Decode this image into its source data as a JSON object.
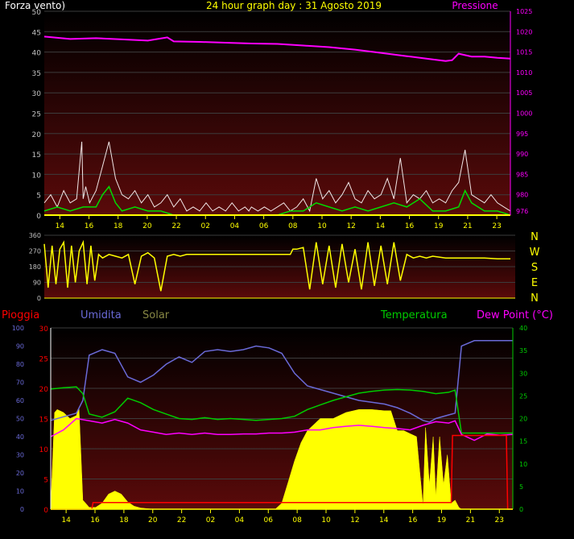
{
  "colors": {
    "background": "#000000",
    "plot_gradient_top": "#000000",
    "plot_gradient_bottom": "#5a0a0a",
    "grid": "#3c3c3c",
    "time_axis": "#ffff00",
    "wind_gust": "#f0e6e6",
    "wind_avg": "#00dd00",
    "pressure": "#ff00ff",
    "direction": "#ffff00",
    "compass": "#ffff00",
    "rain": "#ff0000",
    "humidity": "#6a6ad8",
    "solar": "#ffff00",
    "solar_label": "#888844",
    "temperature": "#00cc00",
    "dewpoint": "#ff00ff",
    "left_axis_text": "#c0c0c0",
    "hum_axis_text": "#6a6ad8"
  },
  "labels": {
    "top_left": "Forza vento)",
    "top_center": "24 hour graph day : 31 Agosto 2019",
    "top_right": "Pressione",
    "rain": "Pioggia",
    "humidity": "Umidita",
    "solar": "Solar",
    "temperature": "Temperatura",
    "dewpoint": "Dew Point (°C)"
  },
  "compass": [
    "N",
    "W",
    "S",
    "E",
    "N"
  ],
  "chart_data": [
    {
      "type": "line",
      "panel": "wind",
      "x_tick_labels": [
        "14",
        "16",
        "18",
        "20",
        "22",
        "02",
        "04",
        "06",
        "08",
        "10",
        "12",
        "14",
        "16",
        "19",
        "21",
        "23"
      ],
      "y_ticks": [
        0,
        5,
        10,
        15,
        20,
        25,
        30,
        35,
        40,
        45,
        50
      ],
      "ylim": [
        0,
        50
      ],
      "y2_ticks": [
        976,
        980,
        985,
        990,
        995,
        1000,
        1005,
        1010,
        1015,
        1020,
        1025
      ],
      "y2lim": [
        975,
        1025
      ],
      "series": [
        {
          "key": "gust",
          "hours": [
            0,
            0.5,
            1,
            1.5,
            2,
            2.5,
            2.9,
            3,
            3.2,
            3.5,
            4,
            4.5,
            5,
            5.5,
            6,
            6.5,
            7,
            7.5,
            8,
            8.5,
            9,
            9.5,
            10,
            10.5,
            11,
            11.5,
            12,
            12.5,
            13,
            13.5,
            14,
            14.5,
            15,
            15.5,
            15.8,
            16,
            16.5,
            17,
            17.5,
            18,
            18.5,
            19,
            19.5,
            20,
            20.5,
            21,
            21.5,
            22,
            22.5,
            23,
            23.5,
            24,
            24.5,
            25,
            25.5,
            26,
            26.5,
            27,
            27.5,
            28,
            28.5,
            29,
            29.5,
            30,
            30.5,
            31,
            31.5,
            32,
            32.5,
            33,
            33.5,
            34,
            34.5,
            35,
            35.5,
            36
          ],
          "values": [
            3,
            5,
            2,
            6,
            3,
            4,
            18,
            4,
            7,
            3,
            6,
            12,
            18,
            9,
            5,
            4,
            6,
            3,
            5,
            2,
            3,
            5,
            2,
            4,
            1,
            2,
            1,
            3,
            1,
            2,
            1,
            3,
            1,
            2,
            1,
            2,
            1,
            2,
            1,
            2,
            3,
            1,
            2,
            4,
            1,
            9,
            4,
            6,
            3,
            5,
            8,
            4,
            3,
            6,
            4,
            5,
            9,
            4,
            14,
            3,
            5,
            4,
            6,
            3,
            4,
            3,
            6,
            8,
            16,
            5,
            4,
            3,
            5,
            3,
            2,
            1
          ]
        },
        {
          "key": "avg",
          "hours": [
            0,
            1,
            2,
            3,
            4,
            4.5,
            5,
            5.5,
            6,
            7,
            8,
            9,
            10,
            11,
            12,
            13,
            14,
            15,
            16,
            17,
            18,
            19,
            20,
            21,
            22,
            23,
            24,
            25,
            26,
            27,
            28,
            29,
            30,
            31,
            32,
            32.5,
            33,
            34,
            35,
            36
          ],
          "values": [
            1,
            2,
            1,
            2,
            2,
            5,
            7,
            3,
            1,
            2,
            1,
            1,
            0,
            0,
            0,
            0,
            0,
            0,
            0,
            0,
            0,
            1,
            1,
            3,
            2,
            1,
            2,
            1,
            2,
            3,
            2,
            4,
            1,
            1,
            2,
            6,
            3,
            1,
            1,
            0
          ]
        },
        {
          "key": "pressure",
          "hours": [
            0,
            2,
            4,
            6,
            8,
            9.5,
            10,
            12,
            14,
            16,
            18,
            20,
            22,
            24,
            26,
            28,
            30,
            31,
            31.5,
            32,
            33,
            34,
            35,
            36
          ],
          "values": [
            1018.8,
            1018.2,
            1018.4,
            1018.1,
            1017.8,
            1018.6,
            1017.6,
            1017.5,
            1017.3,
            1017.1,
            1017.0,
            1016.6,
            1016.2,
            1015.6,
            1014.8,
            1014.0,
            1013.2,
            1012.8,
            1013.0,
            1014.6,
            1013.9,
            1013.9,
            1013.6,
            1013.4
          ]
        }
      ]
    },
    {
      "type": "line",
      "panel": "direction",
      "y_ticks": [
        0,
        90,
        180,
        270,
        360
      ],
      "ylim": [
        0,
        360
      ],
      "series": [
        {
          "key": "direction",
          "hours": [
            0,
            0.3,
            0.6,
            0.9,
            1.2,
            1.5,
            1.8,
            2.1,
            2.4,
            2.7,
            3,
            3.3,
            3.6,
            3.9,
            4.2,
            4.5,
            5,
            5.5,
            6,
            6.5,
            7,
            7.5,
            8,
            8.5,
            9,
            9.5,
            10,
            10.5,
            11,
            11.5,
            12,
            14,
            16,
            18,
            19,
            19.2,
            19.5,
            20,
            20.5,
            21,
            21.5,
            22,
            22.5,
            23,
            23.5,
            24,
            24.5,
            25,
            25.5,
            26,
            26.5,
            27,
            27.5,
            28,
            28.5,
            29,
            29.5,
            30,
            31,
            32,
            33,
            34,
            35,
            36
          ],
          "values": [
            310,
            60,
            300,
            80,
            280,
            320,
            60,
            300,
            90,
            270,
            320,
            80,
            300,
            100,
            250,
            230,
            250,
            240,
            230,
            250,
            80,
            240,
            260,
            230,
            40,
            240,
            250,
            240,
            250,
            250,
            250,
            250,
            250,
            250,
            250,
            280,
            280,
            290,
            50,
            320,
            80,
            300,
            60,
            310,
            90,
            280,
            50,
            320,
            70,
            300,
            80,
            320,
            100,
            250,
            230,
            240,
            230,
            240,
            230,
            230,
            230,
            230,
            225,
            225
          ]
        }
      ]
    },
    {
      "type": "line",
      "panel": "temperature",
      "y_ticks": [
        0,
        5,
        10,
        15,
        20,
        25,
        30
      ],
      "ylim": [
        0,
        30
      ],
      "y_hum_ticks": [
        0,
        10,
        20,
        30,
        40,
        50,
        60,
        70,
        80,
        90,
        100
      ],
      "y_hum_lim": [
        0,
        100
      ],
      "y_right_ticks": [
        0,
        5,
        10,
        15,
        20,
        25,
        30,
        35,
        40
      ],
      "y_right_lim": [
        0,
        40
      ],
      "series": [
        {
          "key": "humidity",
          "hours": [
            0,
            1,
            2,
            2.5,
            3,
            4,
            5,
            6,
            7,
            8,
            9,
            10,
            11,
            12,
            13,
            14,
            15,
            16,
            17,
            18,
            19,
            20,
            21,
            22,
            23,
            24,
            25,
            26,
            27,
            28,
            29,
            29.5,
            30,
            31,
            31.5,
            32,
            33,
            34,
            35,
            36
          ],
          "values": [
            49,
            51,
            53,
            60,
            85,
            88,
            86,
            73,
            70,
            74,
            80,
            84,
            81,
            87,
            88,
            87,
            88,
            90,
            89,
            86,
            75,
            68,
            66,
            64,
            62,
            60,
            59,
            58,
            56,
            53,
            49,
            48,
            50,
            52,
            53,
            90,
            93,
            93,
            93,
            93
          ]
        },
        {
          "key": "temperature",
          "hours": [
            0,
            1,
            2,
            2.5,
            3,
            4,
            5,
            6,
            7,
            8,
            9,
            10,
            11,
            12,
            13,
            14,
            15,
            16,
            17,
            18,
            19,
            20,
            21,
            22,
            23,
            24,
            25,
            26,
            27,
            28,
            29,
            30,
            31,
            31.5,
            32,
            33,
            34,
            35,
            36
          ],
          "values": [
            26.5,
            26.8,
            27.0,
            25.5,
            21,
            20.3,
            21.5,
            24.5,
            23.5,
            22,
            21,
            20,
            19.8,
            20.2,
            19.8,
            20,
            19.8,
            19.6,
            19.8,
            20,
            20.5,
            22,
            23,
            24,
            24.8,
            25.6,
            26,
            26.3,
            26.4,
            26.3,
            26,
            25.5,
            25.8,
            26.3,
            16.8,
            16.8,
            16.8,
            16.8,
            16.8
          ]
        },
        {
          "key": "dewpoint",
          "hours": [
            0,
            1,
            2,
            3,
            4,
            5,
            6,
            7,
            8,
            9,
            10,
            11,
            12,
            13,
            14,
            15,
            16,
            17,
            18,
            19,
            20,
            21,
            22,
            23,
            24,
            25,
            26,
            27,
            28,
            29,
            30,
            31,
            31.5,
            32,
            33,
            34,
            35,
            36
          ],
          "values": [
            16,
            17.5,
            20,
            19.5,
            19,
            19.8,
            19,
            17.5,
            17,
            16.5,
            16.8,
            16.5,
            16.8,
            16.5,
            16.5,
            16.6,
            16.6,
            16.8,
            16.8,
            17,
            17.5,
            17.5,
            18,
            18.3,
            18.5,
            18.3,
            18,
            17.8,
            17.5,
            18.5,
            19.3,
            19.0,
            19.5,
            16.5,
            15.2,
            16.6,
            16.3,
            16.5
          ]
        },
        {
          "key": "solar",
          "hours": [
            0,
            0.3,
            0.5,
            1,
            1.5,
            2,
            2.2,
            2.5,
            2.8,
            3,
            3.5,
            4,
            4.5,
            5,
            5.5,
            6,
            6.5,
            7,
            7.5,
            8,
            8.5,
            10,
            15,
            17,
            17.5,
            18,
            18.5,
            19,
            19.5,
            20,
            21,
            22,
            23,
            24,
            25,
            26,
            26.5,
            27,
            27.5,
            28,
            28.5,
            29,
            29.2,
            29.5,
            29.8,
            30,
            30.3,
            30.6,
            30.9,
            31.2,
            31.5,
            31.8,
            32,
            36
          ],
          "values": [
            0,
            16,
            16.5,
            16,
            15,
            15.5,
            16.8,
            1.5,
            0.8,
            0.3,
            0.3,
            1,
            2.5,
            3,
            2.5,
            1.2,
            0.5,
            0.2,
            0.1,
            0,
            0,
            0,
            0,
            0,
            0,
            1,
            4.5,
            8,
            11,
            13,
            15,
            15,
            16,
            16.5,
            16.5,
            16.3,
            16.3,
            13,
            13,
            12.5,
            12,
            0.5,
            13.5,
            4,
            12,
            2,
            12,
            4,
            9,
            1,
            1.5,
            0.3,
            0,
            0
          ]
        },
        {
          "key": "rain",
          "hours": [
            0,
            0.1,
            3.2,
            3.3,
            31.2,
            31.3,
            35.5,
            35.6,
            36
          ],
          "values": [
            0,
            0,
            0,
            1.1,
            1.1,
            12.2,
            12.2,
            0,
            0
          ]
        }
      ]
    }
  ]
}
